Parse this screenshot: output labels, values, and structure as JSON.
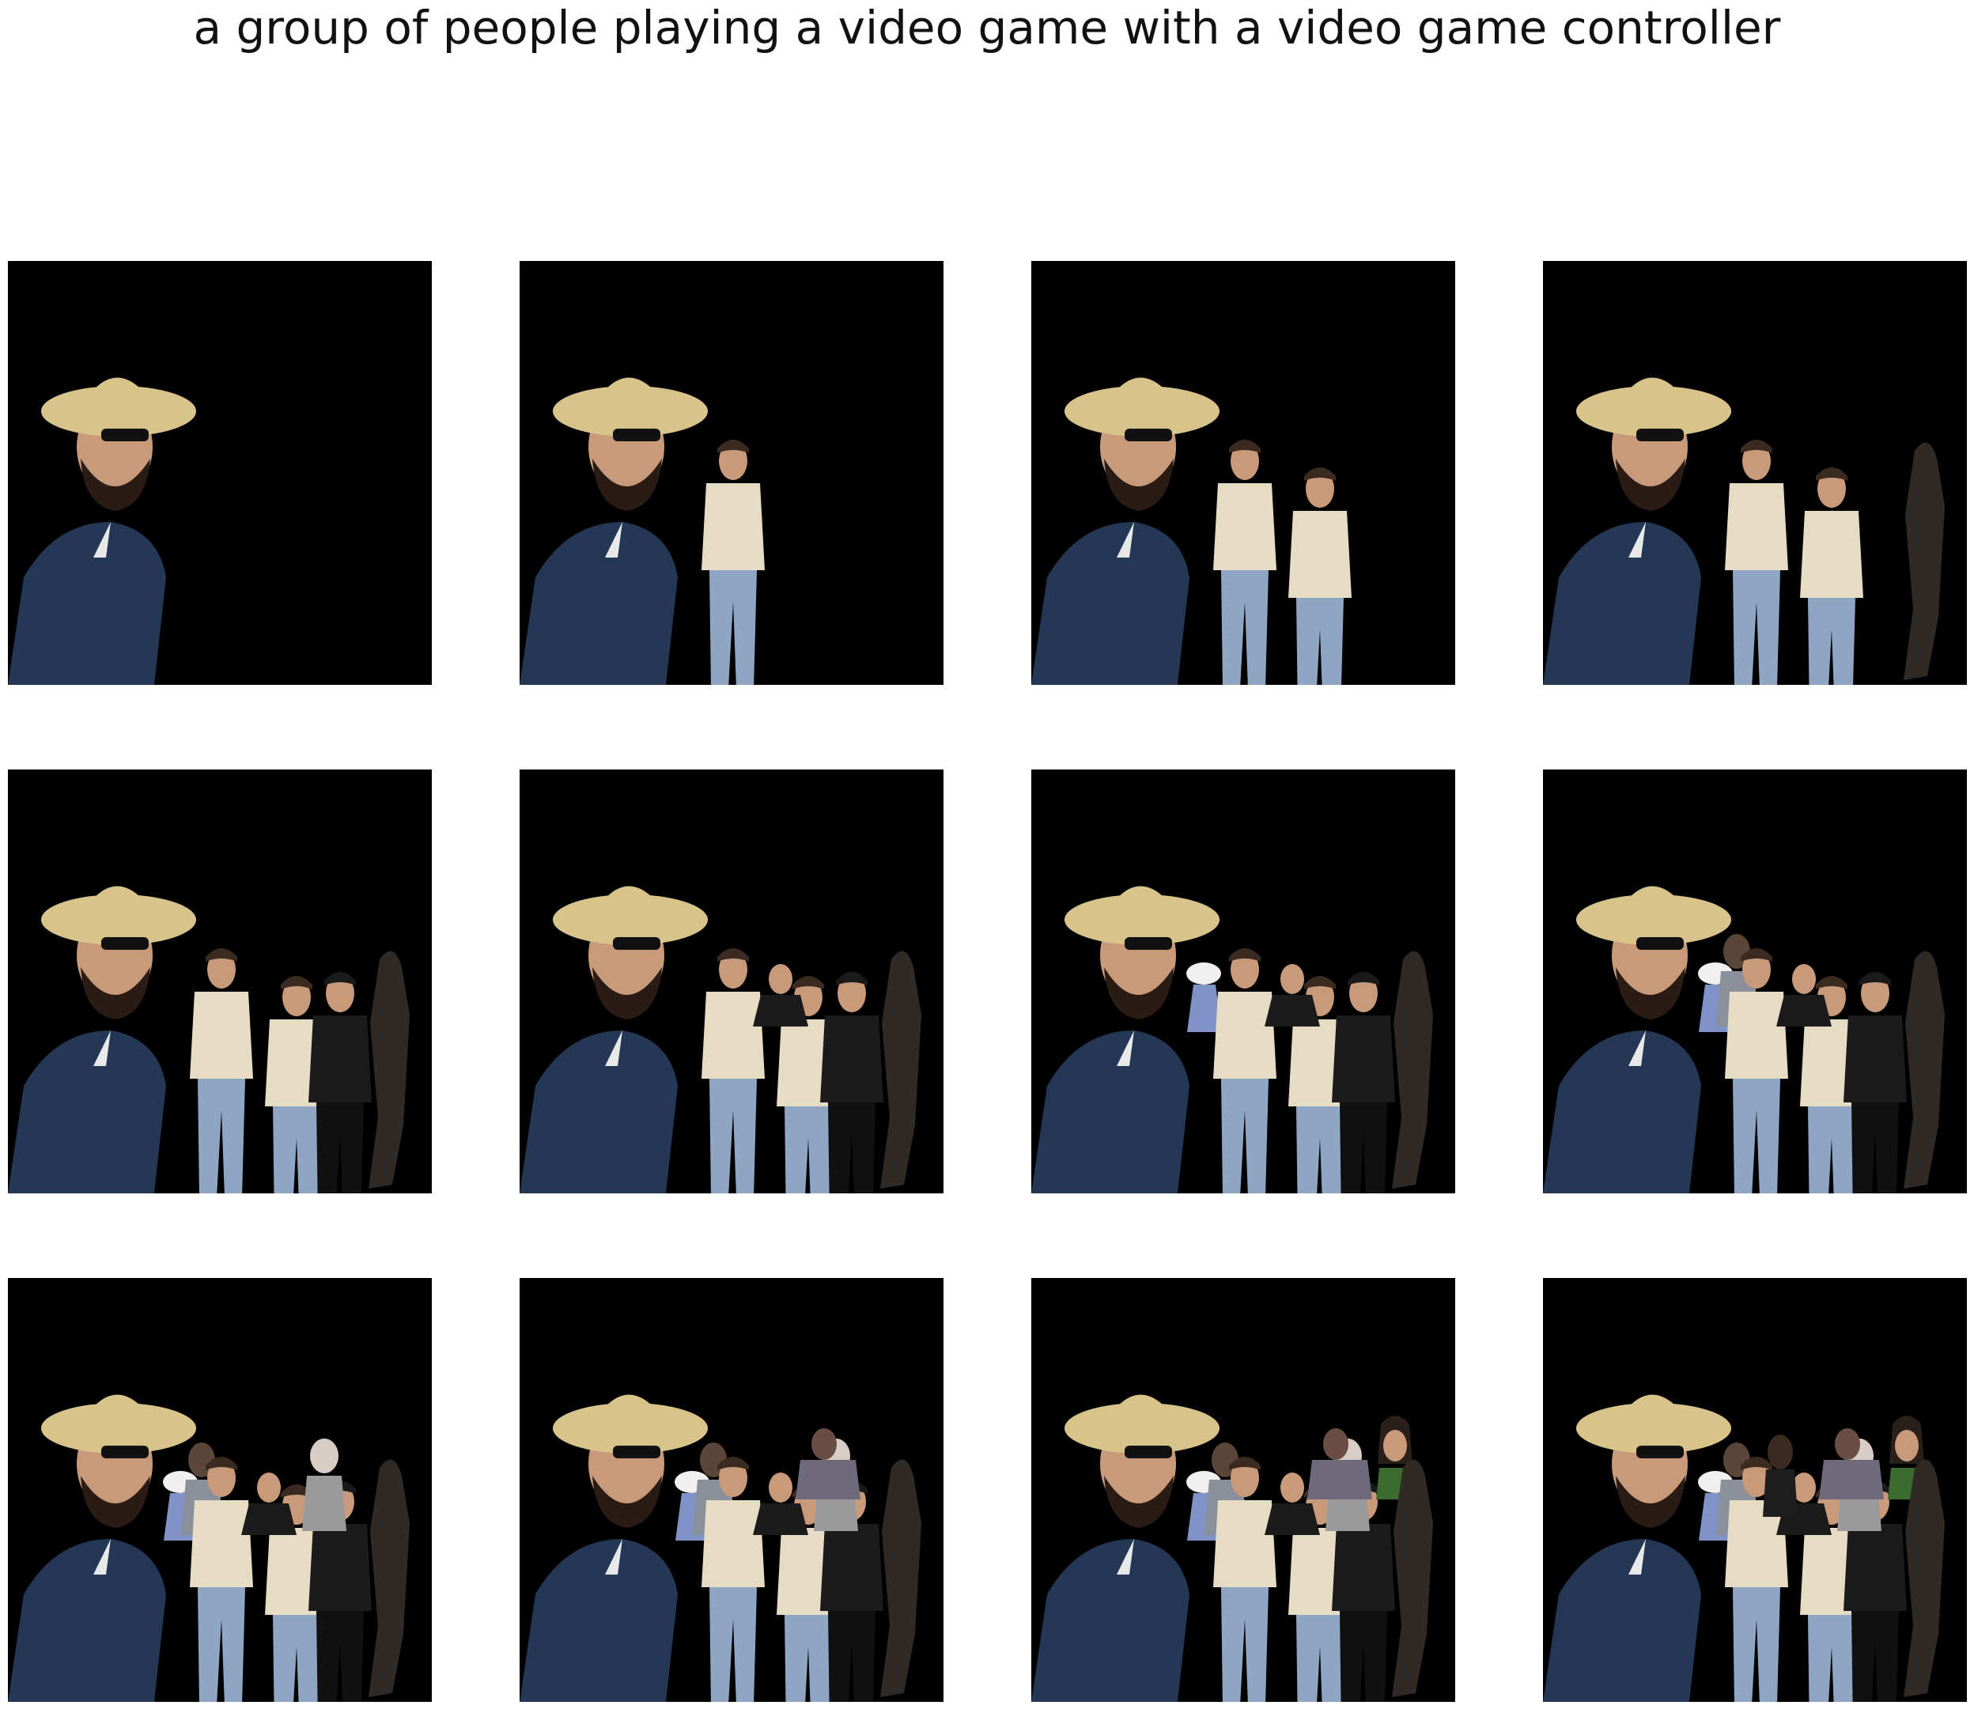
{
  "caption": "a group of people playing a video game with a video game controller",
  "colors": {
    "panel_background": "#000000",
    "page_background": "#ffffff",
    "hat": "#d8c48a",
    "jacket": "#243754",
    "tshirt": "#e6dcc4",
    "jeans": "#8ea6c4",
    "suit": "#1b1b1b",
    "silhouette": "#2f2a26",
    "skin": "#c89a7a",
    "hair_dark": "#3a2a20"
  },
  "panels": [
    {
      "step": 1,
      "figures": [
        "hat-man"
      ]
    },
    {
      "step": 2,
      "figures": [
        "hat-man",
        "tshirt-person-1"
      ]
    },
    {
      "step": 3,
      "figures": [
        "hat-man",
        "tshirt-person-1",
        "tshirt-person-2"
      ]
    },
    {
      "step": 4,
      "figures": [
        "hat-man",
        "tshirt-person-1",
        "tshirt-person-2",
        "dark-silhouette"
      ]
    },
    {
      "step": 5,
      "figures": [
        "hat-man",
        "tshirt-person-1",
        "tshirt-person-2",
        "suit-man-right",
        "dark-silhouette"
      ]
    },
    {
      "step": 6,
      "figures": [
        "hat-man",
        "tshirt-person-1",
        "tshirt-person-2",
        "suit-man-right",
        "suit-man-middle",
        "dark-silhouette"
      ]
    },
    {
      "step": 7,
      "figures": [
        "hat-man",
        "white-cap-person",
        "tshirt-person-1",
        "tshirt-person-2",
        "suit-man-right",
        "suit-man-middle",
        "dark-silhouette"
      ]
    },
    {
      "step": 8,
      "figures": [
        "hat-man",
        "white-cap-person",
        "patterned-shirt-man",
        "tshirt-person-1",
        "tshirt-person-2",
        "suit-man-right",
        "suit-man-middle",
        "dark-silhouette"
      ]
    },
    {
      "step": 9,
      "figures": [
        "hat-man",
        "white-cap-person",
        "patterned-shirt-man",
        "tshirt-person-1",
        "tshirt-person-2",
        "suit-man-right",
        "suit-man-middle",
        "grey-shirt-man",
        "dark-silhouette"
      ]
    },
    {
      "step": 10,
      "figures": [
        "hat-man",
        "white-cap-person",
        "patterned-shirt-man",
        "tshirt-person-1",
        "tshirt-person-2",
        "suit-man-right",
        "suit-man-middle",
        "grey-shirt-man",
        "purple-shirt-man",
        "dark-silhouette"
      ]
    },
    {
      "step": 11,
      "figures": [
        "hat-man",
        "white-cap-person",
        "patterned-shirt-man",
        "tshirt-person-1",
        "tshirt-person-2",
        "suit-man-right",
        "suit-man-middle",
        "grey-shirt-man",
        "purple-shirt-man",
        "smiling-woman",
        "dark-silhouette"
      ]
    },
    {
      "step": 12,
      "figures": [
        "hat-man",
        "white-cap-person",
        "patterned-shirt-man",
        "tshirt-person-1",
        "tshirt-person-2",
        "suit-man-right",
        "suit-man-middle",
        "grey-shirt-man",
        "purple-shirt-man",
        "smiling-woman",
        "tall-dark-haired-man",
        "dark-silhouette"
      ]
    }
  ]
}
